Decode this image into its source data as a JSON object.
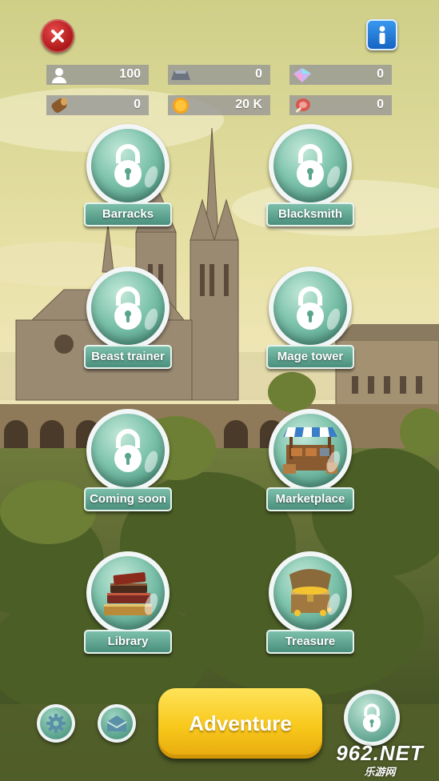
{
  "top_bar": {
    "close_icon": "close-icon",
    "info_icon": "info-icon"
  },
  "resources": [
    {
      "icon": "population-icon",
      "value": "100"
    },
    {
      "icon": "iron-icon",
      "value": "0"
    },
    {
      "icon": "crystal-icon",
      "value": "0"
    },
    {
      "icon": "wood-icon",
      "value": "0"
    },
    {
      "icon": "gold-coin-icon",
      "value": "20 K"
    },
    {
      "icon": "meat-icon",
      "value": "0"
    }
  ],
  "buildings": [
    {
      "label": "Barracks",
      "locked": true
    },
    {
      "label": "Blacksmith",
      "locked": true
    },
    {
      "label": "Beast trainer",
      "locked": true
    },
    {
      "label": "Mage tower",
      "locked": true
    },
    {
      "label": "Coming soon",
      "locked": true
    },
    {
      "label": "Marketplace",
      "locked": false,
      "icon": "market-stall-icon"
    },
    {
      "label": "Library",
      "locked": false,
      "icon": "books-icon"
    },
    {
      "label": "Treasure",
      "locked": false,
      "icon": "treasure-chest-icon"
    }
  ],
  "bottom_bar": {
    "adventure_label": "Adventure",
    "watermark_main": "962.NET",
    "watermark_sub": "乐游网"
  },
  "colors": {
    "bubble_teal": "#7fc4ad",
    "plate_teal": "#5a9f8a",
    "adventure_yellow": "#f8c81b",
    "close_red": "#c62020",
    "info_blue": "#2a7fdc"
  }
}
